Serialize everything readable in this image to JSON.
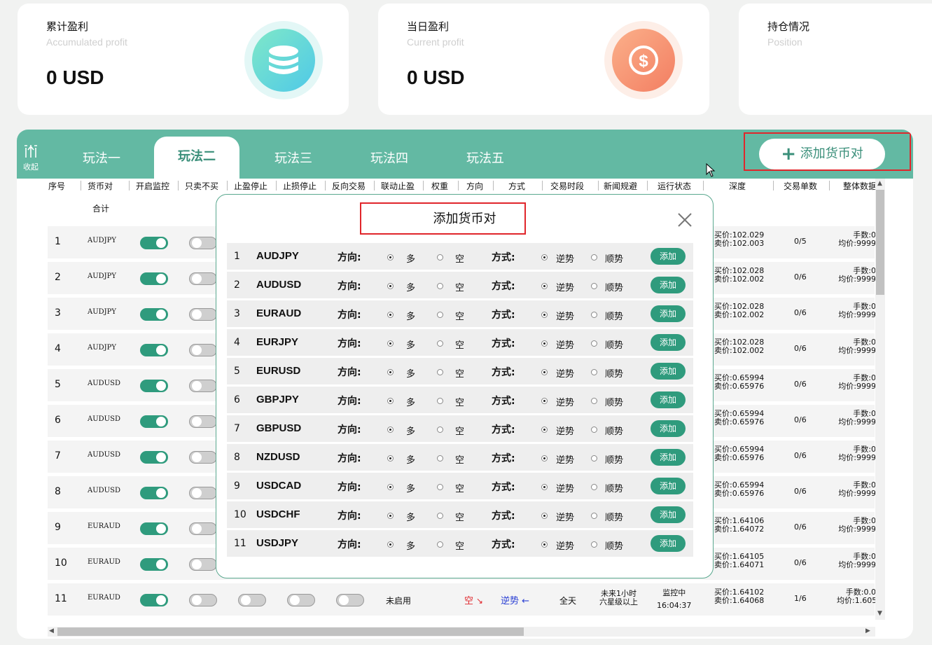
{
  "cards": [
    {
      "title": "累计盈利",
      "subtitle": "Accumulated profit",
      "value": "0 USD",
      "icon": "coins-icon",
      "color": "#5fd9d1"
    },
    {
      "title": "当日盈利",
      "subtitle": "Current profit",
      "value": "0 USD",
      "icon": "dollar-icon",
      "color": "#f58f6c"
    },
    {
      "title": "持仓情况",
      "subtitle": "Position",
      "value": ""
    }
  ],
  "toolbar": {
    "collapse_label": "收起",
    "add_pair_label": "添加货币对"
  },
  "tabs": [
    "玩法一",
    "玩法二",
    "玩法三",
    "玩法四",
    "玩法五"
  ],
  "active_tab": "玩法二",
  "columns": [
    "序号",
    "货币对",
    "开启监控",
    "只卖不买",
    "止盈停止",
    "止损停止",
    "反向交易",
    "联动止盈",
    "权重",
    "方向",
    "方式",
    "交易时段",
    "新闻规避",
    "运行状态",
    "深度",
    "交易单数",
    "整体数据"
  ],
  "total_label": "合计",
  "table_rows": [
    {
      "n": "1",
      "pair": "AUDJPY",
      "bid": "买价:102.029",
      "ask": "卖价:102.003",
      "count": "0/5",
      "fee": "手数:0",
      "avg": "均价:9999"
    },
    {
      "n": "2",
      "pair": "AUDJPY",
      "bid": "买价:102.028",
      "ask": "卖价:102.002",
      "count": "0/6",
      "fee": "手数:0",
      "avg": "均价:9999"
    },
    {
      "n": "3",
      "pair": "AUDJPY",
      "bid": "买价:102.028",
      "ask": "卖价:102.002",
      "count": "0/6",
      "fee": "手数:0",
      "avg": "均价:9999"
    },
    {
      "n": "4",
      "pair": "AUDJPY",
      "bid": "买价:102.028",
      "ask": "卖价:102.002",
      "count": "0/6",
      "fee": "手数:0",
      "avg": "均价:9999"
    },
    {
      "n": "5",
      "pair": "AUDUSD",
      "bid": "买价:0.65994",
      "ask": "卖价:0.65976",
      "count": "0/6",
      "fee": "手数:0",
      "avg": "均价:9999"
    },
    {
      "n": "6",
      "pair": "AUDUSD",
      "bid": "买价:0.65994",
      "ask": "卖价:0.65976",
      "count": "0/6",
      "fee": "手数:0",
      "avg": "均价:9999"
    },
    {
      "n": "7",
      "pair": "AUDUSD",
      "bid": "买价:0.65994",
      "ask": "卖价:0.65976",
      "count": "0/6",
      "fee": "手数:0",
      "avg": "均价:9999"
    },
    {
      "n": "8",
      "pair": "AUDUSD",
      "bid": "买价:0.65994",
      "ask": "卖价:0.65976",
      "count": "0/6",
      "fee": "手数:0",
      "avg": "均价:9999"
    },
    {
      "n": "9",
      "pair": "EURAUD",
      "bid": "买价:1.64106",
      "ask": "卖价:1.64072",
      "count": "0/6",
      "fee": "手数:0",
      "avg": "均价:9999"
    },
    {
      "n": "10",
      "pair": "EURAUD",
      "bid": "买价:1.64105",
      "ask": "卖价:1.64071",
      "count": "0/6",
      "fee": "手数:0",
      "avg": "均价:9999"
    },
    {
      "n": "11",
      "pair": "EURAUD",
      "bid": "买价:1.64102",
      "ask": "卖价:1.64068",
      "count": "1/6",
      "fee": "手数:0.0",
      "avg": "均价:1.605"
    }
  ],
  "row11": {
    "linked": "未启用",
    "direction": "空",
    "mode": "逆势",
    "session": "全天",
    "news1": "未来1小时",
    "news2": "六星级以上",
    "status": "监控中",
    "time": "16:04:37"
  },
  "modal": {
    "title": "添加货币对",
    "direction_label": "方向:",
    "mode_label": "方式:",
    "long": "多",
    "short": "空",
    "counter": "逆势",
    "trend": "顺势",
    "add_label": "添加",
    "pairs": [
      "AUDJPY",
      "AUDUSD",
      "EURAUD",
      "EURJPY",
      "EURUSD",
      "GBPJPY",
      "GBPUSD",
      "NZDUSD",
      "USDCAD",
      "USDCHF",
      "USDJPY"
    ]
  },
  "colors": {
    "accent": "#63b9a3",
    "toggle_on": "#2f9b7d",
    "highlight": "#e0262b"
  }
}
